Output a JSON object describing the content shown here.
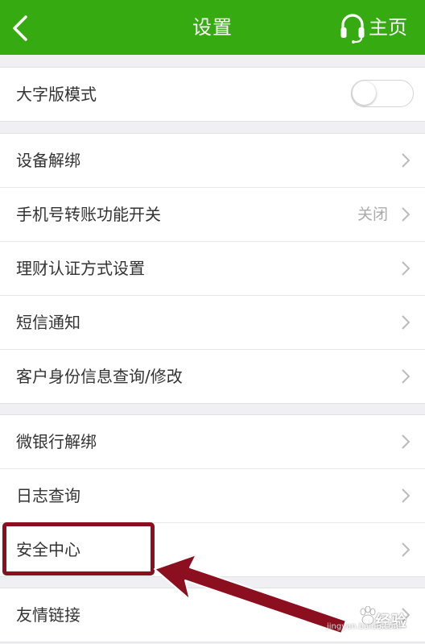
{
  "header": {
    "title": "设置",
    "home_label": "主页",
    "bg_color": "#36ab11"
  },
  "group1": {
    "items": [
      {
        "label": "大字版模式",
        "control": "toggle",
        "toggle_on": false
      }
    ]
  },
  "group2": {
    "items": [
      {
        "label": "设备解绑",
        "value": ""
      },
      {
        "label": "手机号转账功能开关",
        "value": "关闭"
      },
      {
        "label": "理财认证方式设置",
        "value": ""
      },
      {
        "label": "短信通知",
        "value": ""
      },
      {
        "label": "客户身份信息查询/修改",
        "value": ""
      }
    ]
  },
  "group3": {
    "items": [
      {
        "label": "微银行解绑",
        "value": ""
      },
      {
        "label": "日志查询",
        "value": ""
      },
      {
        "label": "安全中心",
        "value": ""
      }
    ]
  },
  "group4": {
    "items": [
      {
        "label": "友情链接",
        "value": ""
      }
    ]
  },
  "annotation": {
    "highlight_color": "#8b0f1e",
    "highlighted_item": "安全中心"
  },
  "watermark": {
    "text": "经验",
    "sub": "jingyan.baidu.com"
  },
  "icons": {
    "back": "chevron-left-icon",
    "home": "headset-icon",
    "row": "chevron-right-icon"
  }
}
